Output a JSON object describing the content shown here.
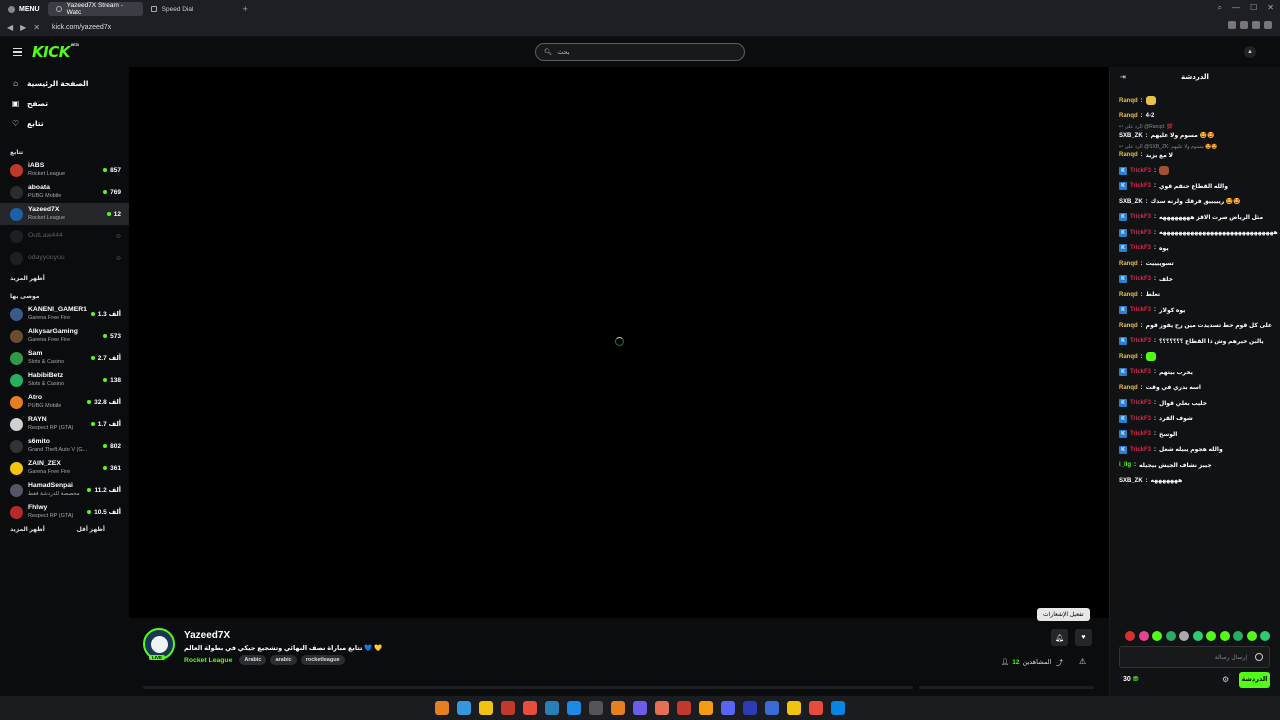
{
  "browser": {
    "menu_label": "MENU",
    "tabs": [
      {
        "label": "Yazeed7X Stream - Watc"
      },
      {
        "label": "Speed Dial"
      }
    ],
    "new_tab": "+",
    "url": "kick.com/yazeed7x"
  },
  "header": {
    "logo": "KICK",
    "beta": "BETA",
    "search_placeholder": "بحث"
  },
  "sidebar": {
    "nav": [
      {
        "label": "الصفحة الرئيسية",
        "icon": "home-icon"
      },
      {
        "label": "تصفح",
        "icon": "browse-icon"
      },
      {
        "label": "تتابع",
        "icon": "heart-icon"
      }
    ],
    "following_title": "تتابع",
    "following": [
      {
        "name": "iABS",
        "game": "Rocket League",
        "viewers": "857",
        "color": "#c0392b"
      },
      {
        "name": "aboata",
        "game": "PUBG Mobile",
        "viewers": "769",
        "color": "#2c2c2c"
      },
      {
        "name": "Yazeed7X",
        "game": "Rocket League",
        "viewers": "12",
        "color": "#1d5fa8"
      },
      {
        "name": "OutLaw444",
        "game": "",
        "viewers": "",
        "color": "#444"
      },
      {
        "name": "odayyouyou",
        "game": "",
        "viewers": "",
        "color": "#444"
      }
    ],
    "show_more": "أظهر المزيد",
    "recommended_title": "موصى بها",
    "recommended": [
      {
        "name": "KANENI_GAMER1",
        "game": "Garena Free Fire",
        "viewers": "1.3 ألف",
        "color": "#3b5a8a"
      },
      {
        "name": "AlkysarGaming",
        "game": "Garena Free Fire",
        "viewers": "573",
        "color": "#6b4d2e"
      },
      {
        "name": "Sam",
        "game": "Slots & Casino",
        "viewers": "2.7 ألف",
        "color": "#2e9a48"
      },
      {
        "name": "HabibiBetz",
        "game": "Slots & Casino",
        "viewers": "138",
        "color": "#27ae60"
      },
      {
        "name": "Atro",
        "game": "PUBG Mobile",
        "viewers": "32.8 ألف",
        "color": "#e67e22"
      },
      {
        "name": "RAYN",
        "game": "Respect RP (GTA)",
        "viewers": "1.7 ألف",
        "color": "#d0d0d0"
      },
      {
        "name": "s6mito",
        "game": "Grand Theft Auto V (G...",
        "viewers": "802",
        "color": "#333"
      },
      {
        "name": "ZAIN_ZEX",
        "game": "Garena Free Fire",
        "viewers": "361",
        "color": "#f1c40f"
      },
      {
        "name": "HamadSenpai",
        "game": "مخصصة للدردشة فقط",
        "viewers": "11.2 ألف",
        "color": "#556"
      },
      {
        "name": "Fhlwy",
        "game": "Respect RP (GTA)",
        "viewers": "10.5 ألف",
        "color": "#b52b2b"
      }
    ],
    "show_more_2": "أظهر المزيد",
    "show_less": "أظهر أقل"
  },
  "stream": {
    "name": "Yazeed7X",
    "title": "تتابع مباراة نصف النهائي وتشجيع جيكي في بطولة العالم 💙 💛",
    "category": "Rocket League",
    "tags": [
      "Arabic",
      "arabic",
      "rocketleague"
    ],
    "viewers_label": "المشاهدين",
    "viewers": "12",
    "tooltip": "تفعيل الإشعارات",
    "live": "LIVE"
  },
  "chat": {
    "title": "الدردشة",
    "input_placeholder": "إرسال رسالة",
    "points": "30",
    "send_label": "الدردشة",
    "messages": [
      {
        "user": "Ranqd",
        "text": "",
        "ucolor": "#e8c14a",
        "emote": "#e8c14a"
      },
      {
        "user": "Ranqd",
        "text": "4-2",
        "ucolor": "#e8c14a"
      },
      {
        "reply": "↩ الرد على @Ranqd: 💯",
        "user": "SXB_ZK",
        "text": "مسوم ولا عليهم 🤩🤩",
        "ucolor": "#ffffff"
      },
      {
        "reply": "↩ الرد على @SXB_ZK: مسوم ولا عليهم 🤩🤩",
        "user": "Ranqd",
        "text": "لا مع يزيد",
        "ucolor": "#e8c14a"
      },
      {
        "user": "TrickF3",
        "text": "",
        "ucolor": "#e0264f",
        "kick": true,
        "emote": "#a0522d"
      },
      {
        "user": "TrickF3",
        "text": "والله القطاع حنقم قوي",
        "ucolor": "#e0264f",
        "kick": true
      },
      {
        "user": "SXB_ZK",
        "text": "ريييييق فرقك ولرنه سدك 🤩🤩",
        "ucolor": "#ffffff"
      },
      {
        "user": "TrickF3",
        "text": "مثل الرياض صرت الاقز ههههههههه",
        "ucolor": "#e0264f",
        "kick": true
      },
      {
        "user": "TrickF3",
        "text": "هههههههههههههههههههههههههههههه",
        "ucolor": "#e0264f",
        "kick": true
      },
      {
        "user": "TrickF3",
        "text": "يوه",
        "ucolor": "#e0264f",
        "kick": true
      },
      {
        "user": "Ranqd",
        "text": "تسوييييت",
        "ucolor": "#e8c14a"
      },
      {
        "user": "TrickF3",
        "text": "خلف",
        "ucolor": "#e0264f",
        "kick": true
      },
      {
        "user": "Ranqd",
        "text": "تعلط",
        "ucolor": "#e8c14a"
      },
      {
        "user": "TrickF3",
        "text": "يوه كولار",
        "ucolor": "#e0264f",
        "kick": true
      },
      {
        "user": "Ranqd",
        "text": "على كل قوم حط تسديدت مين رح يفوز قوم",
        "ucolor": "#e8c14a"
      },
      {
        "user": "TrickF3",
        "text": "يالبن خيرهم وش ذا القطاع ؟؟؟؟؟؟؟",
        "ucolor": "#e0264f",
        "kick": true
      },
      {
        "user": "Ranqd",
        "text": "",
        "ucolor": "#e8c14a",
        "emote": "#53fc18"
      },
      {
        "user": "TrickF3",
        "text": "يخرب بيتهم",
        "ucolor": "#e0264f",
        "kick": true
      },
      {
        "user": "Ranqd",
        "text": "اسه بدري في وقت",
        "ucolor": "#e8c14a"
      },
      {
        "user": "TrickF3",
        "text": "خليب بعلي قوال",
        "ucolor": "#e0264f",
        "kick": true
      },
      {
        "user": "TrickF3",
        "text": "شوف القرد",
        "ucolor": "#e0264f",
        "kick": true
      },
      {
        "user": "TrickF3",
        "text": "الوسخ",
        "ucolor": "#e0264f",
        "kick": true
      },
      {
        "user": "TrickF3",
        "text": "والله هجوم يبيله شغل",
        "ucolor": "#e0264f",
        "kick": true
      },
      {
        "user": "i_llg",
        "text": "جيبز نشاف الجيش بيجيله",
        "ucolor": "#53fc18"
      },
      {
        "user": "SXB_ZK",
        "text": "هههههههه",
        "ucolor": "#ffffff"
      }
    ]
  },
  "colors": {
    "accent": "#53fc18",
    "bg": "#0b0c0d"
  }
}
